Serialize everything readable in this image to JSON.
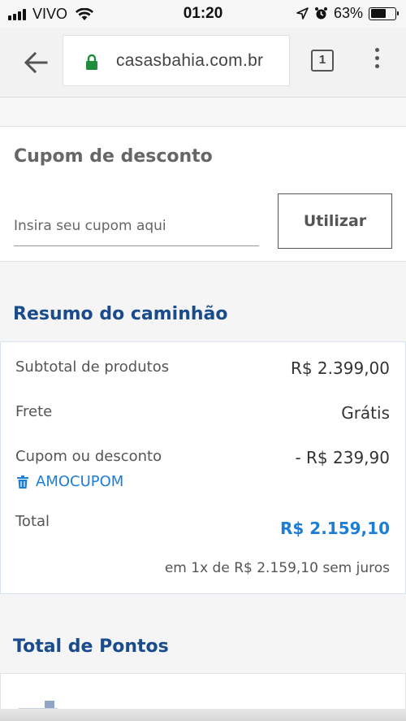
{
  "status_bar": {
    "carrier": "VIVO",
    "time": "01:20",
    "battery_percent": "63%",
    "battery_level": 0.63
  },
  "browser": {
    "url": "casasbahia.com.br",
    "tab_count": "1"
  },
  "coupon": {
    "title": "Cupom de desconto",
    "input_placeholder": "Insira seu cupom aqui",
    "input_value": "",
    "apply_label": "Utilizar"
  },
  "summary": {
    "title": "Resumo do caminhão",
    "subtotal_label": "Subtotal de produtos",
    "subtotal_value": "R$ 2.399,00",
    "shipping_label": "Frete",
    "shipping_value": "Grátis",
    "discount_label": "Cupom ou desconto",
    "discount_value": "- R$ 239,90",
    "coupon_code": "AMOCUPOM",
    "total_label": "Total",
    "total_value": "R$ 2.159,10",
    "installments": "em 1x de R$ 2.159,10 sem juros"
  },
  "points": {
    "title": "Total de Pontos"
  },
  "colors": {
    "heading_blue": "#1a4c8b",
    "link_blue": "#1c7ed6",
    "lock_green": "#1e8e3e"
  }
}
